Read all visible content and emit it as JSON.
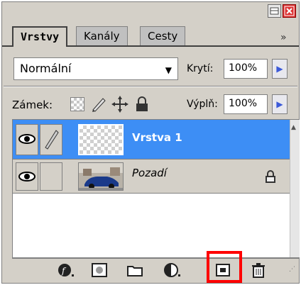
{
  "tabs": [
    {
      "label": "Vrstvy"
    },
    {
      "label": "Kanály"
    },
    {
      "label": "Cesty"
    }
  ],
  "panel_menu": "»",
  "blend_mode": "Normální",
  "opacity": {
    "label": "Krytí:",
    "value": "100%"
  },
  "lock": {
    "label": "Zámek:"
  },
  "fill": {
    "label": "Výplň:",
    "value": "100%"
  },
  "layers": [
    {
      "name": "Vrstva 1"
    },
    {
      "name": "Pozadí"
    }
  ]
}
